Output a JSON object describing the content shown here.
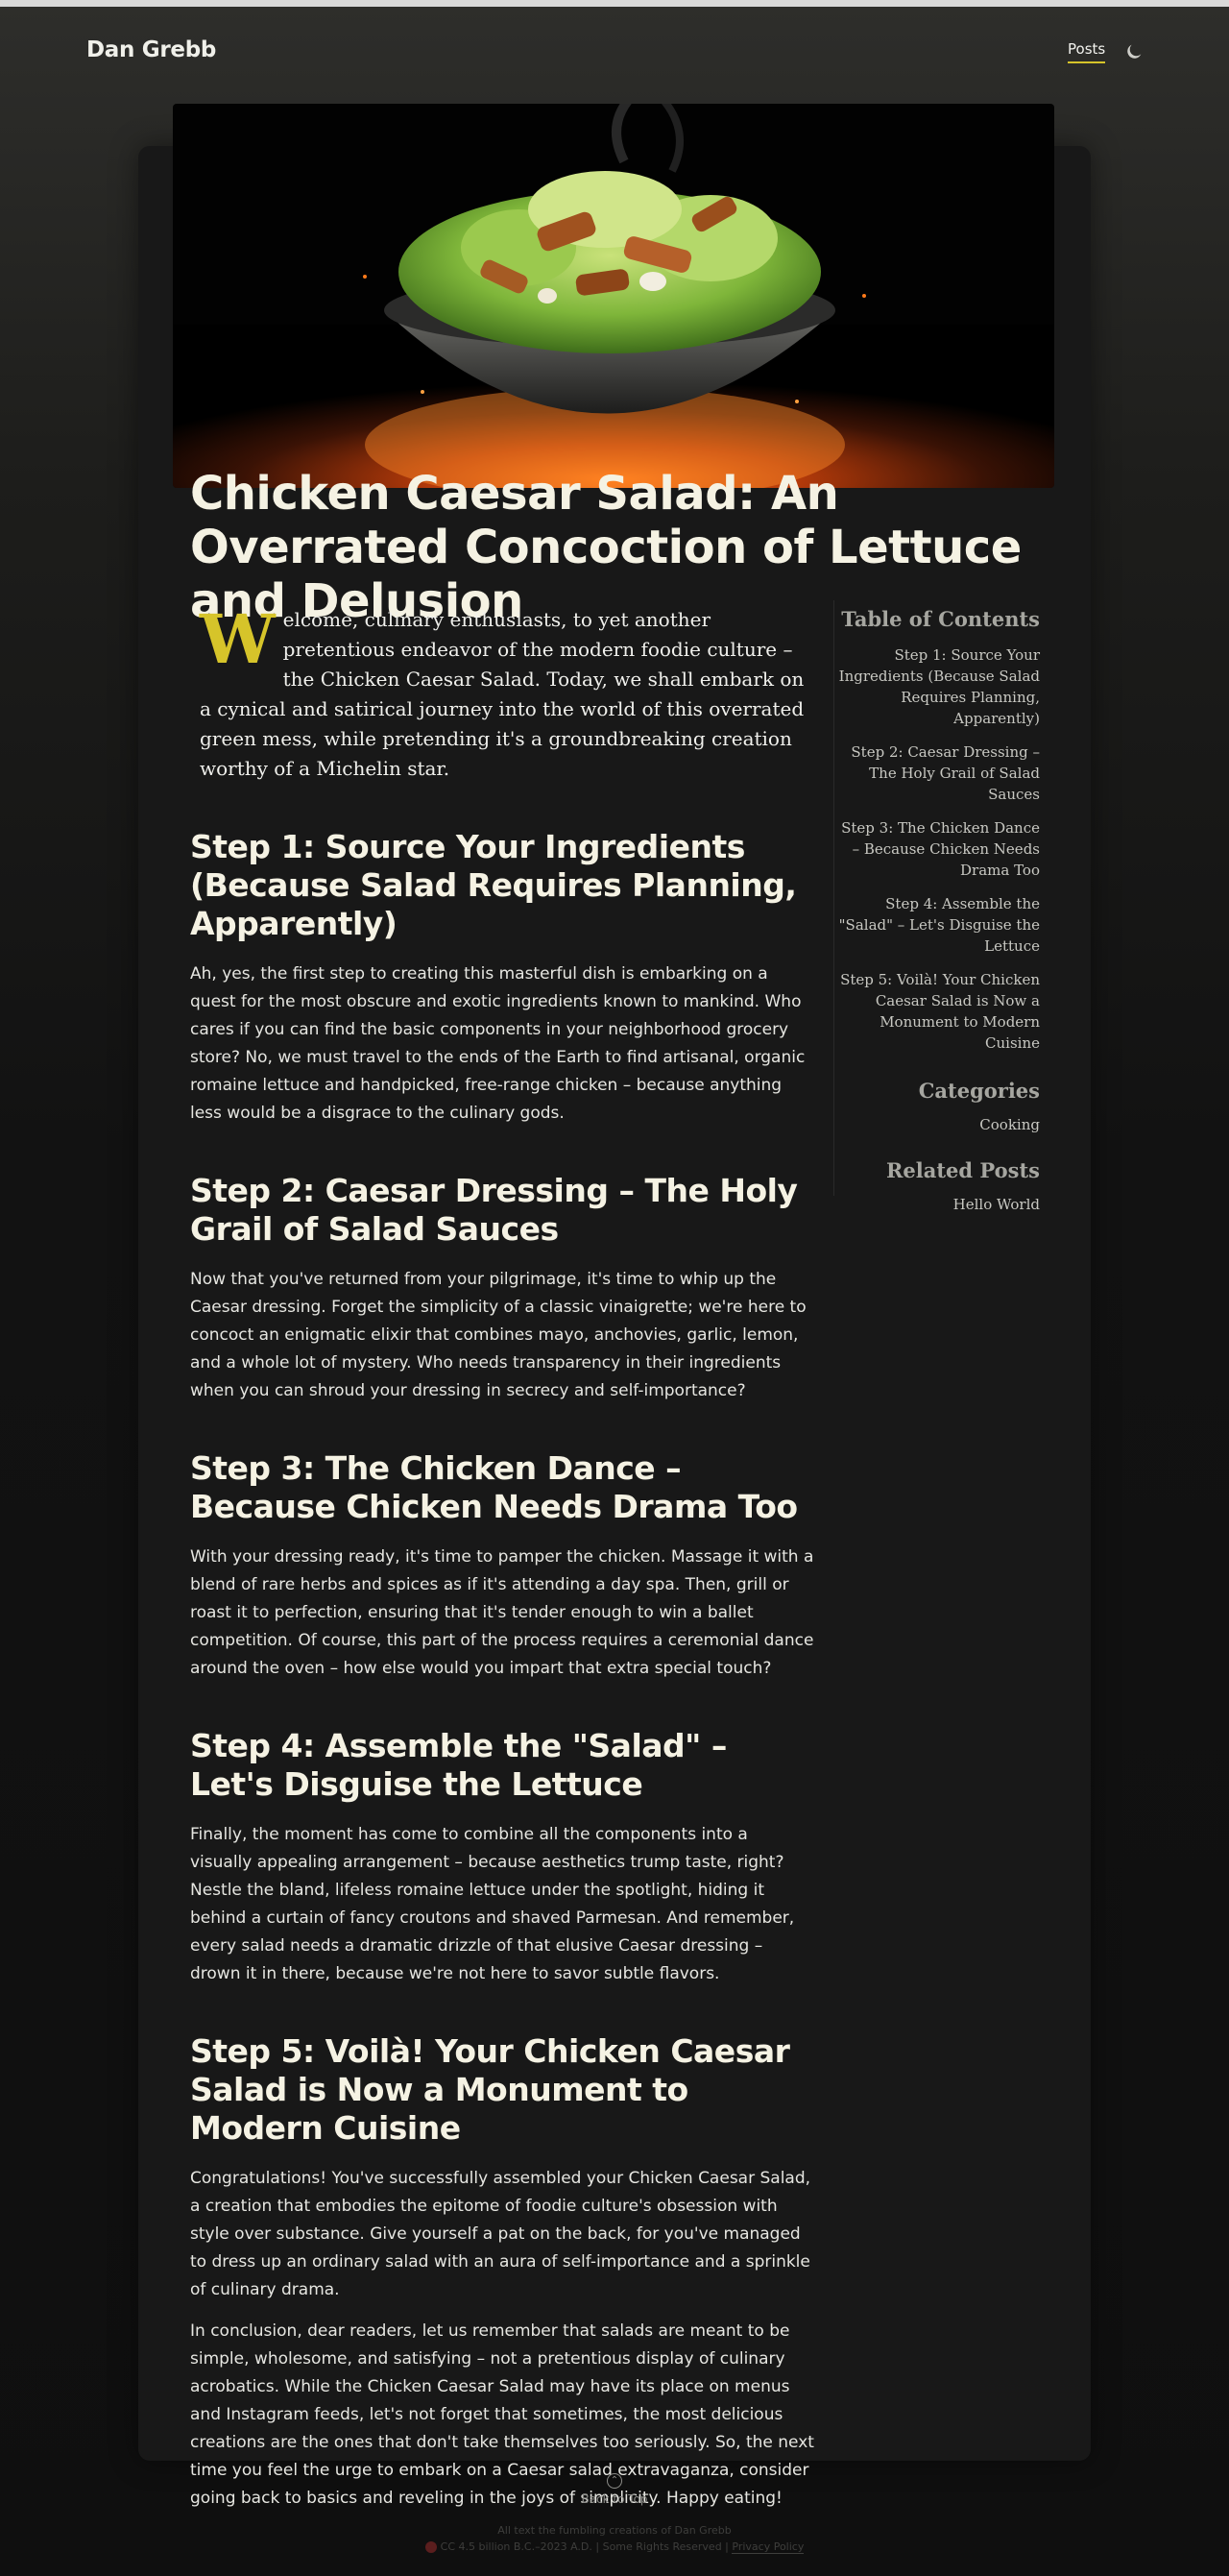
{
  "site": {
    "brand": "Dan Grebb"
  },
  "nav": {
    "posts": "Posts",
    "theme_icon": "moon-icon"
  },
  "article": {
    "title": "Chicken Caesar Salad: An Overrated Concoction of Lettuce and Delusion",
    "dropcap": "W",
    "intro": "elcome, culinary enthusiasts, to yet another pretentious endeavor of the modern foodie culture – the Chicken Caesar Salad. Today, we shall embark on a cynical and satirical journey into the world of this overrated green mess, while pretending it's a groundbreaking creation worthy of a Michelin star.",
    "sections": [
      {
        "heading": "Step 1: Source Your Ingredients (Because Salad Requires Planning, Apparently)",
        "paragraphs": [
          "Ah, yes, the first step to creating this masterful dish is embarking on a quest for the most obscure and exotic ingredients known to mankind. Who cares if you can find the basic components in your neighborhood grocery store? No, we must travel to the ends of the Earth to find artisanal, organic romaine lettuce and handpicked, free-range chicken – because anything less would be a disgrace to the culinary gods."
        ]
      },
      {
        "heading": "Step 2: Caesar Dressing – The Holy Grail of Salad Sauces",
        "paragraphs": [
          "Now that you've returned from your pilgrimage, it's time to whip up the Caesar dressing. Forget the simplicity of a classic vinaigrette; we're here to concoct an enigmatic elixir that combines mayo, anchovies, garlic, lemon, and a whole lot of mystery. Who needs transparency in their ingredients when you can shroud your dressing in secrecy and self-importance?"
        ]
      },
      {
        "heading": "Step 3: The Chicken Dance – Because Chicken Needs Drama Too",
        "paragraphs": [
          "With your dressing ready, it's time to pamper the chicken. Massage it with a blend of rare herbs and spices as if it's attending a day spa. Then, grill or roast it to perfection, ensuring that it's tender enough to win a ballet competition. Of course, this part of the process requires a ceremonial dance around the oven – how else would you impart that extra special touch?"
        ]
      },
      {
        "heading": "Step 4: Assemble the \"Salad\" – Let's Disguise the Lettuce",
        "paragraphs": [
          "Finally, the moment has come to combine all the components into a visually appealing arrangement – because aesthetics trump taste, right? Nestle the bland, lifeless romaine lettuce under the spotlight, hiding it behind a curtain of fancy croutons and shaved Parmesan. And remember, every salad needs a dramatic drizzle of that elusive Caesar dressing – drown it in there, because we're not here to savor subtle flavors."
        ]
      },
      {
        "heading": "Step 5: Voilà! Your Chicken Caesar Salad is Now a Monument to Modern Cuisine",
        "paragraphs": [
          "Congratulations! You've successfully assembled your Chicken Caesar Salad, a creation that embodies the epitome of foodie culture's obsession with style over substance. Give yourself a pat on the back, for you've managed to dress up an ordinary salad with an aura of self-importance and a sprinkle of culinary drama.",
          "In conclusion, dear readers, let us remember that salads are meant to be simple, wholesome, and satisfying – not a pretentious display of culinary acrobatics. While the Chicken Caesar Salad may have its place on menus and Instagram feeds, let's not forget that sometimes, the most delicious creations are the ones that don't take themselves too seriously. So, the next time you feel the urge to embark on a Caesar salad extravaganza, consider going back to basics and reveling in the joys of simplicity. Happy eating!"
        ]
      }
    ]
  },
  "sidebar": {
    "toc_title": "Table of Contents",
    "toc": [
      "Step 1: Source Your Ingredients (Because Salad Requires Planning, Apparently)",
      "Step 2: Caesar Dressing – The Holy Grail of Salad Sauces",
      "Step 3: The Chicken Dance – Because Chicken Needs Drama Too",
      "Step 4: Assemble the \"Salad\" – Let's Disguise the Lettuce",
      "Step 5: Voilà! Your Chicken Caesar Salad is Now a Monument to Modern Cuisine"
    ],
    "categories_title": "Categories",
    "category": "Cooking",
    "related_title": "Related Posts",
    "related": "Hello World"
  },
  "footer": {
    "back_to_top": "Back to Top",
    "credit": "All text the fumbling creations of Dan Grebb",
    "license": "CC 4.5 billion B.C.–2023 A.D. | Some Rights Reserved |",
    "privacy": "Privacy Policy"
  },
  "colors": {
    "accent": "#d6c42a",
    "background": "#121212",
    "card": "#181818"
  }
}
